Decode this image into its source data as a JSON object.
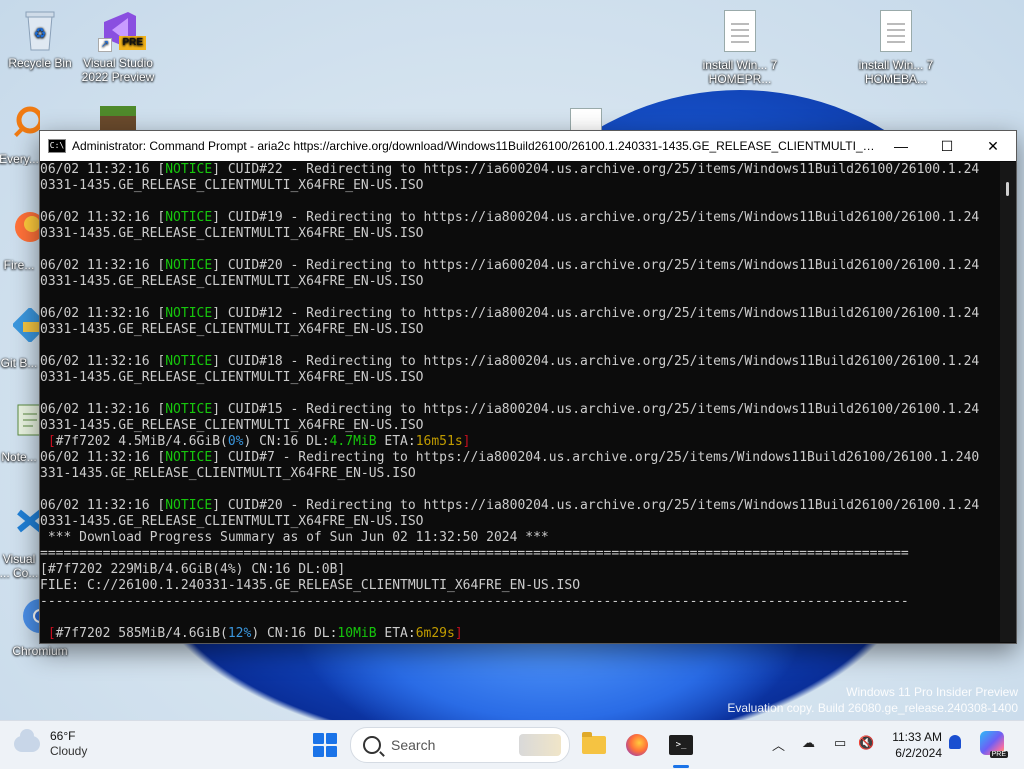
{
  "desktop": {
    "icons": [
      {
        "label": "Recycle Bin"
      },
      {
        "label": "Visual Studio 2022 Preview",
        "badge": "PRE"
      },
      {
        "label": "install Win... 7 HOMEPR..."
      },
      {
        "label": "install Win... 7 HOMEBA..."
      },
      {
        "label": "Every..."
      },
      {
        "label": "Fire..."
      },
      {
        "label": "Git B..."
      },
      {
        "label": "Note..."
      },
      {
        "label": "Visual ... Co..."
      },
      {
        "label": "Chromium"
      }
    ],
    "watermark": {
      "line1": "Windows 11 Pro Insider Preview",
      "line2": "Evaluation copy. Build 26080.ge_release.240308-1400"
    }
  },
  "window": {
    "title": "Administrator: Command Prompt - aria2c  https://archive.org/download/Windows11Build26100/26100.1.240331-1435.GE_RELEASE_CLIENTMULTI_X64FR...",
    "icon_text": "C:\\",
    "controls": {
      "minimize": "—",
      "maximize": "☐",
      "close": "✕"
    },
    "lines": [
      [
        {
          "t": "06/02 11:32:16 ["
        },
        {
          "t": "NOTICE",
          "c": "g"
        },
        {
          "t": "] CUID#22 - Redirecting to https://ia600204.us.archive.org/25/items/Windows11Build26100/26100.1.24"
        }
      ],
      [
        {
          "t": "0331-1435.GE_RELEASE_CLIENTMULTI_X64FRE_EN-US.ISO"
        }
      ],
      [
        {
          "t": ""
        }
      ],
      [
        {
          "t": "06/02 11:32:16 ["
        },
        {
          "t": "NOTICE",
          "c": "g"
        },
        {
          "t": "] CUID#19 - Redirecting to https://ia800204.us.archive.org/25/items/Windows11Build26100/26100.1.24"
        }
      ],
      [
        {
          "t": "0331-1435.GE_RELEASE_CLIENTMULTI_X64FRE_EN-US.ISO"
        }
      ],
      [
        {
          "t": ""
        }
      ],
      [
        {
          "t": "06/02 11:32:16 ["
        },
        {
          "t": "NOTICE",
          "c": "g"
        },
        {
          "t": "] CUID#20 - Redirecting to https://ia600204.us.archive.org/25/items/Windows11Build26100/26100.1.24"
        }
      ],
      [
        {
          "t": "0331-1435.GE_RELEASE_CLIENTMULTI_X64FRE_EN-US.ISO"
        }
      ],
      [
        {
          "t": ""
        }
      ],
      [
        {
          "t": "06/02 11:32:16 ["
        },
        {
          "t": "NOTICE",
          "c": "g"
        },
        {
          "t": "] CUID#12 - Redirecting to https://ia800204.us.archive.org/25/items/Windows11Build26100/26100.1.24"
        }
      ],
      [
        {
          "t": "0331-1435.GE_RELEASE_CLIENTMULTI_X64FRE_EN-US.ISO"
        }
      ],
      [
        {
          "t": ""
        }
      ],
      [
        {
          "t": "06/02 11:32:16 ["
        },
        {
          "t": "NOTICE",
          "c": "g"
        },
        {
          "t": "] CUID#18 - Redirecting to https://ia800204.us.archive.org/25/items/Windows11Build26100/26100.1.24"
        }
      ],
      [
        {
          "t": "0331-1435.GE_RELEASE_CLIENTMULTI_X64FRE_EN-US.ISO"
        }
      ],
      [
        {
          "t": ""
        }
      ],
      [
        {
          "t": "06/02 11:32:16 ["
        },
        {
          "t": "NOTICE",
          "c": "g"
        },
        {
          "t": "] CUID#15 - Redirecting to https://ia800204.us.archive.org/25/items/Windows11Build26100/26100.1.24"
        }
      ],
      [
        {
          "t": "0331-1435.GE_RELEASE_CLIENTMULTI_X64FRE_EN-US.ISO"
        }
      ],
      [
        {
          "t": " [",
          "c": "r"
        },
        {
          "t": "#7f7202 4.5MiB/4.6GiB("
        },
        {
          "t": "0%",
          "c": "c"
        },
        {
          "t": ") CN:16 DL:"
        },
        {
          "t": "4.7MiB",
          "c": "g"
        },
        {
          "t": " ETA:"
        },
        {
          "t": "16m51s",
          "c": "y"
        },
        {
          "t": "]",
          "c": "r"
        }
      ],
      [
        {
          "t": "06/02 11:32:16 ["
        },
        {
          "t": "NOTICE",
          "c": "g"
        },
        {
          "t": "] CUID#7 - Redirecting to https://ia800204.us.archive.org/25/items/Windows11Build26100/26100.1.240"
        }
      ],
      [
        {
          "t": "331-1435.GE_RELEASE_CLIENTMULTI_X64FRE_EN-US.ISO"
        }
      ],
      [
        {
          "t": ""
        }
      ],
      [
        {
          "t": "06/02 11:32:16 ["
        },
        {
          "t": "NOTICE",
          "c": "g"
        },
        {
          "t": "] CUID#20 - Redirecting to https://ia800204.us.archive.org/25/items/Windows11Build26100/26100.1.24"
        }
      ],
      [
        {
          "t": "0331-1435.GE_RELEASE_CLIENTMULTI_X64FRE_EN-US.ISO"
        }
      ],
      [
        {
          "t": " *** Download Progress Summary as of Sun Jun 02 11:32:50 2024 ***"
        }
      ],
      [
        {
          "t": "==============================================================================================================="
        }
      ],
      [
        {
          "t": "[#7f7202 229MiB/4.6GiB(4%) CN:16 DL:0B]"
        }
      ],
      [
        {
          "t": "FILE: C://26100.1.240331-1435.GE_RELEASE_CLIENTMULTI_X64FRE_EN-US.ISO"
        }
      ],
      [
        {
          "t": "---------------------------------------------------------------------------------------------------------------"
        }
      ],
      [
        {
          "t": ""
        }
      ],
      [
        {
          "t": " [",
          "c": "r"
        },
        {
          "t": "#7f7202 585MiB/4.6GiB("
        },
        {
          "t": "12%",
          "c": "c"
        },
        {
          "t": ") CN:16 DL:"
        },
        {
          "t": "10MiB",
          "c": "g"
        },
        {
          "t": " ETA:"
        },
        {
          "t": "6m29s",
          "c": "y"
        },
        {
          "t": "]",
          "c": "r"
        }
      ]
    ]
  },
  "taskbar": {
    "weather": {
      "temp": "66°F",
      "condition": "Cloudy"
    },
    "search_label": "Search",
    "clock": {
      "time": "11:33 AM",
      "date": "6/2/2024"
    },
    "accent": "#1a73e8"
  }
}
